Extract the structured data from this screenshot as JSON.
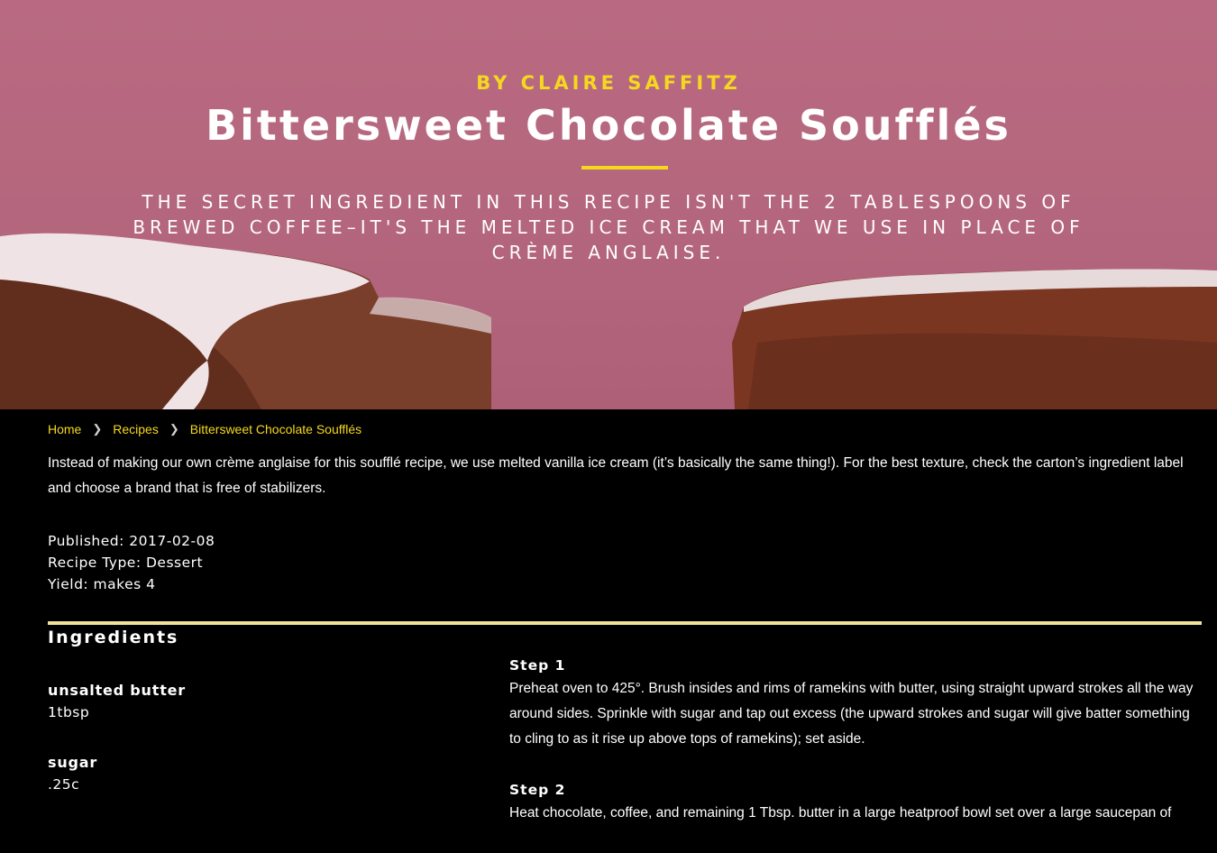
{
  "hero": {
    "byline": "BY CLAIRE SAFFITZ",
    "title": "Bittersweet Chocolate Soufflés",
    "subtitle": "The secret ingredient in this recipe isn't the 2 tablespoons of brewed coffee–it's the melted ice cream that we use in place of crème anglaise.",
    "image": "chocolate-souffle-photo",
    "colors": {
      "background": "#b5677e",
      "accent": "#f5d81e"
    }
  },
  "breadcrumb": {
    "items": [
      "Home",
      "Recipes",
      "Bittersweet Chocolate Soufflés"
    ]
  },
  "intro": "Instead of making our own crème anglaise for this soufflé recipe, we use melted vanilla ice cream (it’s basically the same thing!). For the best texture, check the carton’s ingredient label and choose a brand that is free of stabilizers.",
  "meta": {
    "published": "Published: 2017-02-08",
    "recipe_type": "Recipe Type: Dessert",
    "yield": "Yield: makes 4"
  },
  "ingredients": {
    "heading": "Ingredients",
    "items": [
      {
        "name": "unsalted butter",
        "qty": "1tbsp"
      },
      {
        "name": "sugar",
        "qty": ".25c"
      }
    ]
  },
  "steps": [
    {
      "label": "Step 1",
      "text": "Preheat oven to 425°. Brush insides and rims of ramekins with butter, using straight upward strokes all the way around sides. Sprinkle with sugar and tap out excess (the upward strokes and sugar will give batter something to cling to as it rise up above tops of ramekins); set aside."
    },
    {
      "label": "Step 2",
      "text": "Heat chocolate, coffee, and remaining 1 Tbsp. butter in a large heatproof bowl set over a large saucepan of"
    }
  ]
}
